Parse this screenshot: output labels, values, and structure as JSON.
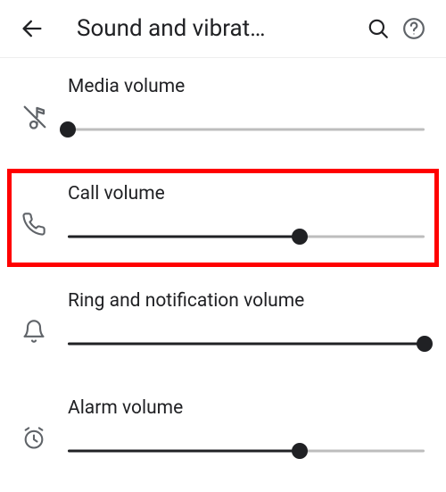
{
  "header": {
    "title": "Sound and vibrat…"
  },
  "sliders": {
    "media": {
      "label": "Media volume",
      "value": 0
    },
    "call": {
      "label": "Call volume",
      "value": 65,
      "highlighted": true
    },
    "ring": {
      "label": "Ring and notification volume",
      "value": 100
    },
    "alarm": {
      "label": "Alarm volume",
      "value": 65
    }
  }
}
